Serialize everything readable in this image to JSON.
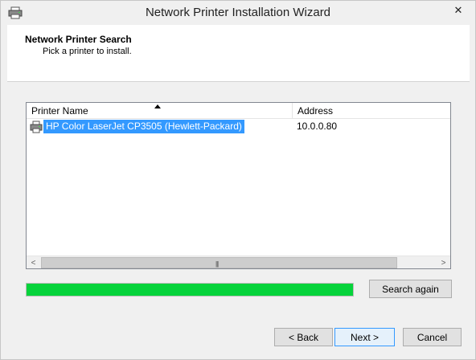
{
  "window": {
    "title": "Network Printer Installation Wizard",
    "close_glyph": "✕",
    "icon": "printer-icon"
  },
  "header": {
    "title": "Network Printer Search",
    "subtitle": "Pick a printer to install."
  },
  "printer_list": {
    "columns": [
      "Printer Name",
      "Address"
    ],
    "sort_column": "Printer Name",
    "sort_direction": "ascending",
    "rows": [
      {
        "name": "HP Color LaserJet CP3505 (Hewlett-Packard)",
        "address": "10.0.0.80",
        "selected": true,
        "icon": "printer-icon"
      }
    ],
    "scrollbar": {
      "left_arrow": "<",
      "right_arrow": ">",
      "grip": "|||"
    }
  },
  "search": {
    "progress_fraction": 1.0,
    "progress_color": "#06d33b",
    "search_again_label": "Search again"
  },
  "footer": {
    "back_label": "< Back",
    "next_label": "Next >",
    "cancel_label": "Cancel"
  },
  "colors": {
    "selection": "#3399ff",
    "default_button_border": "#3399ff"
  }
}
